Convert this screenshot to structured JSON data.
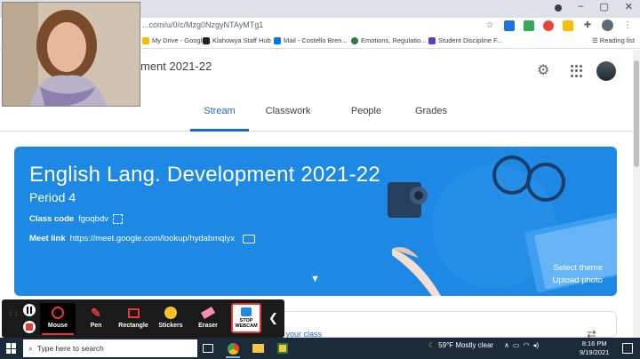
{
  "browser": {
    "url": "...com/u/0/c/Mzg0NzgyNTAyMTg1",
    "bookmarks": [
      {
        "label": "My Drive - Google...",
        "color": "#fbbc04"
      },
      {
        "label": "Klahowya Staff Hub",
        "color": "#222222"
      },
      {
        "label": "Mail - Costello Bren...",
        "color": "#0078d4"
      },
      {
        "label": "Emotions, Regulatio...",
        "color": "#2e7d32"
      },
      {
        "label": "Student Discipline F...",
        "color": "#673ab7"
      }
    ],
    "reading_list": "Reading list"
  },
  "header": {
    "class_title": "ment 2021-22",
    "tabs": [
      {
        "label": "Stream",
        "active": true
      },
      {
        "label": "Classwork",
        "active": false
      },
      {
        "label": "People",
        "active": false
      },
      {
        "label": "Grades",
        "active": false
      }
    ]
  },
  "banner": {
    "title": "English Lang. Development 2021-22",
    "section": "Period 4",
    "class_code_label": "Class code",
    "class_code": "fgoqbdv",
    "meet_label": "Meet link",
    "meet_url": "https://meet.google.com/lookup/hydabmqlyx",
    "select_theme": "Select theme",
    "upload_photo": "Upload photo",
    "color": "#1e88e5"
  },
  "stream": {
    "announce_text": "o your class"
  },
  "recorder": {
    "tools": [
      {
        "label": "Mouse",
        "icon": "mouse-icon",
        "active": true
      },
      {
        "label": "Pen",
        "icon": "pen-icon",
        "active": false
      },
      {
        "label": "Rectangle",
        "icon": "rectangle-icon",
        "active": false
      },
      {
        "label": "Stickers",
        "icon": "sticker-icon",
        "active": false
      },
      {
        "label": "Eraser",
        "icon": "eraser-icon",
        "active": false
      }
    ],
    "webcam_button": "STOP WEBCAM"
  },
  "taskbar": {
    "search_placeholder": "Type here to search",
    "weather": "59°F  Mostly clear",
    "time": "8:16 PM",
    "date": "9/19/2021"
  }
}
